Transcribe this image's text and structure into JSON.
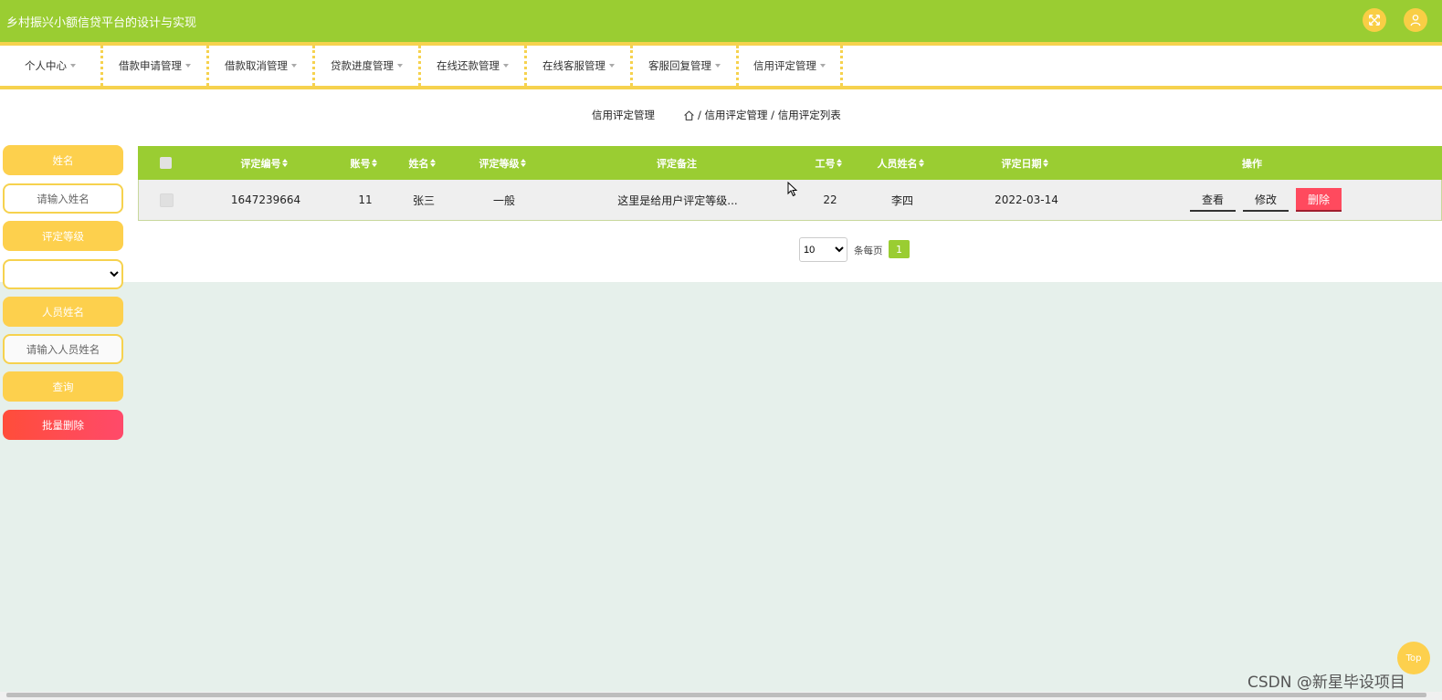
{
  "app": {
    "title": "乡村振兴小额信贷平台的设计与实现"
  },
  "header_icons": {
    "fullscreen": "fullscreen-icon",
    "user": "user-icon"
  },
  "nav": {
    "items": [
      {
        "label": "个人中心"
      },
      {
        "label": "借款申请管理"
      },
      {
        "label": "借款取消管理"
      },
      {
        "label": "贷款进度管理"
      },
      {
        "label": "在线还款管理"
      },
      {
        "label": "在线客服管理"
      },
      {
        "label": "客服回复管理"
      },
      {
        "label": "信用评定管理"
      }
    ]
  },
  "breadcrumb": {
    "title": "信用评定管理",
    "path": "/ 信用评定管理 / 信用评定列表"
  },
  "search": {
    "name_label": "姓名",
    "name_placeholder": "请输入姓名",
    "grade_label": "评定等级",
    "staff_label": "人员姓名",
    "staff_placeholder": "请输入人员姓名",
    "query_button": "查询",
    "batch_delete_button": "批量删除"
  },
  "table": {
    "headers": [
      "评定编号",
      "账号",
      "姓名",
      "评定等级",
      "评定备注",
      "工号",
      "人员姓名",
      "评定日期",
      "操作"
    ],
    "rows": [
      {
        "id": "1647239664",
        "account": "11",
        "name": "张三",
        "grade": "一般",
        "remark": "这里是给用户评定等级...",
        "staff_no": "22",
        "staff_name": "李四",
        "date": "2022-03-14"
      }
    ],
    "actions": {
      "view": "查看",
      "edit": "修改",
      "delete": "删除"
    }
  },
  "pagination": {
    "page_size": "10",
    "per_page_label": "条每页",
    "current_page": "1"
  },
  "back_to_top": "Top",
  "watermark": "CSDN @新星毕设项目",
  "colors": {
    "primary": "#9acd32",
    "accent": "#f6d24e",
    "label": "#fdd04d",
    "danger": "#ff4a5e",
    "background": "#e6f0eb"
  }
}
